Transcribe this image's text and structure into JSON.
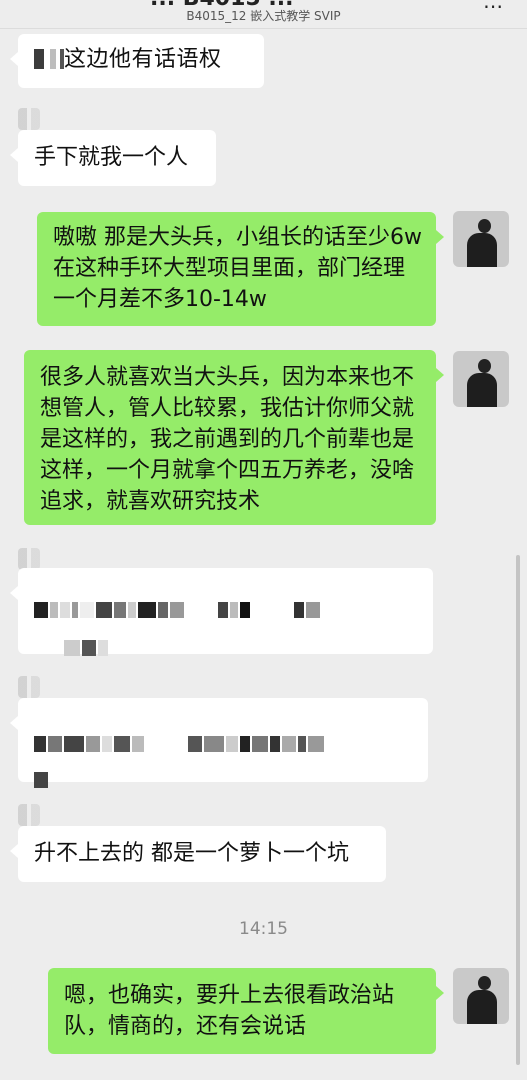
{
  "header": {
    "title_fragment": "... B4015 ...",
    "subtitle": "B4015_12 嵌入式教学 SVIP",
    "more_icon": "more-dots-icon"
  },
  "messages": [
    {
      "side": "left",
      "text": "这边他有话语权",
      "partially_redacted": true
    },
    {
      "side": "left",
      "text": "手下就我一个人"
    },
    {
      "side": "right",
      "text": "嗷嗷 那是大头兵，小组长的话至少6w在这种手环大型项目里面，部门经理一个月差不多10-14w"
    },
    {
      "side": "right",
      "text": "很多人就喜欢当大头兵，因为本来也不想管人，管人比较累，我估计你师父就是这样的，我之前遇到的几个前辈也是这样，一个月就拿个四五万养老，没啥追求，就喜欢研究技术"
    },
    {
      "side": "left",
      "text": "",
      "redacted": true
    },
    {
      "side": "left",
      "text": "",
      "redacted": true
    },
    {
      "side": "left",
      "text": "升不上去的 都是一个萝卜一个坑"
    },
    {
      "side": "right",
      "text": "嗯，也确实，要升上去很看政治站队，情商的，还有会说话"
    }
  ],
  "timestamp": "14:15",
  "colors": {
    "background": "#ededed",
    "bubble_right": "#95ec69",
    "bubble_left": "#ffffff"
  }
}
